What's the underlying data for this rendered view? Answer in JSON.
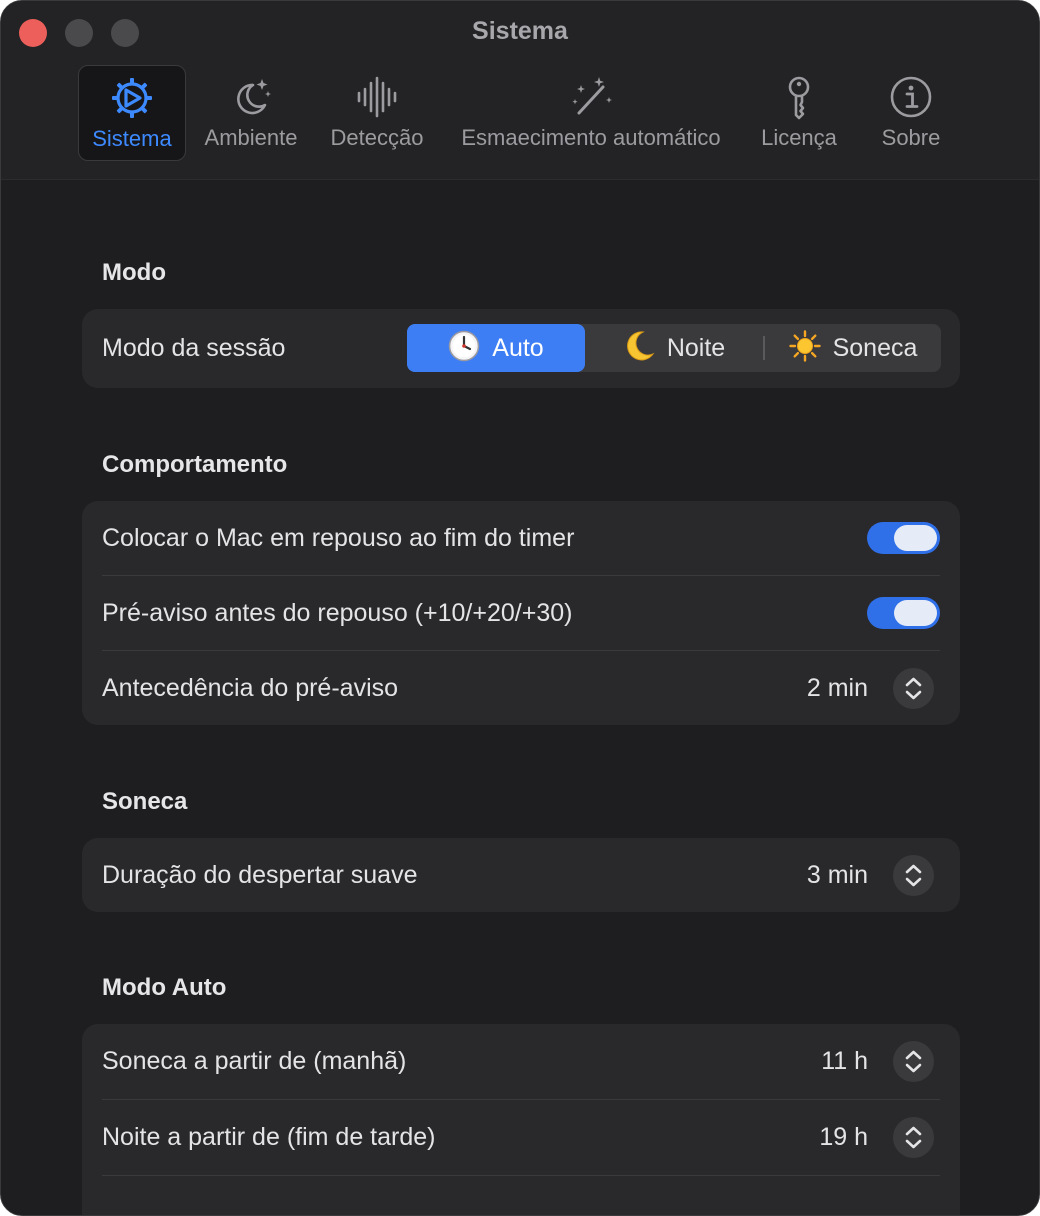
{
  "window": {
    "title": "Sistema"
  },
  "tabs": [
    {
      "label": "Sistema",
      "icon": "gear-icon",
      "active": true
    },
    {
      "label": "Ambiente",
      "icon": "moon-stars-icon",
      "active": false
    },
    {
      "label": "Detecção",
      "icon": "waveform-icon",
      "active": false
    },
    {
      "label": "Esmaecimento automático",
      "icon": "magic-wand-icon",
      "active": false
    },
    {
      "label": "Licença",
      "icon": "key-icon",
      "active": false
    },
    {
      "label": "Sobre",
      "icon": "info-icon",
      "active": false
    }
  ],
  "sections": {
    "modo": {
      "title": "Modo",
      "session_label": "Modo da sessão",
      "segments": [
        {
          "label": "Auto",
          "icon": "clock-icon",
          "selected": true
        },
        {
          "label": "Noite",
          "icon": "crescent-moon-icon",
          "selected": false
        },
        {
          "label": "Soneca",
          "icon": "sun-icon",
          "selected": false
        }
      ]
    },
    "comportamento": {
      "title": "Comportamento",
      "rows": [
        {
          "label": "Colocar o Mac em repouso ao fim do timer",
          "toggle": true
        },
        {
          "label": "Pré-aviso antes do repouso (+10/+20/+30)",
          "toggle": true
        },
        {
          "label": "Antecedência do pré-aviso",
          "value": "2 min"
        }
      ]
    },
    "soneca": {
      "title": "Soneca",
      "rows": [
        {
          "label": "Duração do despertar suave",
          "value": "3 min"
        }
      ]
    },
    "modo_auto": {
      "title": "Modo Auto",
      "rows": [
        {
          "label": "Soneca a partir de (manhã)",
          "value": "11 h"
        },
        {
          "label": "Noite a partir de (fim de tarde)",
          "value": "19 h"
        }
      ]
    }
  },
  "colors": {
    "accent": "#3e7ef5",
    "background": "#1e1e20",
    "card": "#29292b",
    "close_button": "#ec5f5a"
  }
}
